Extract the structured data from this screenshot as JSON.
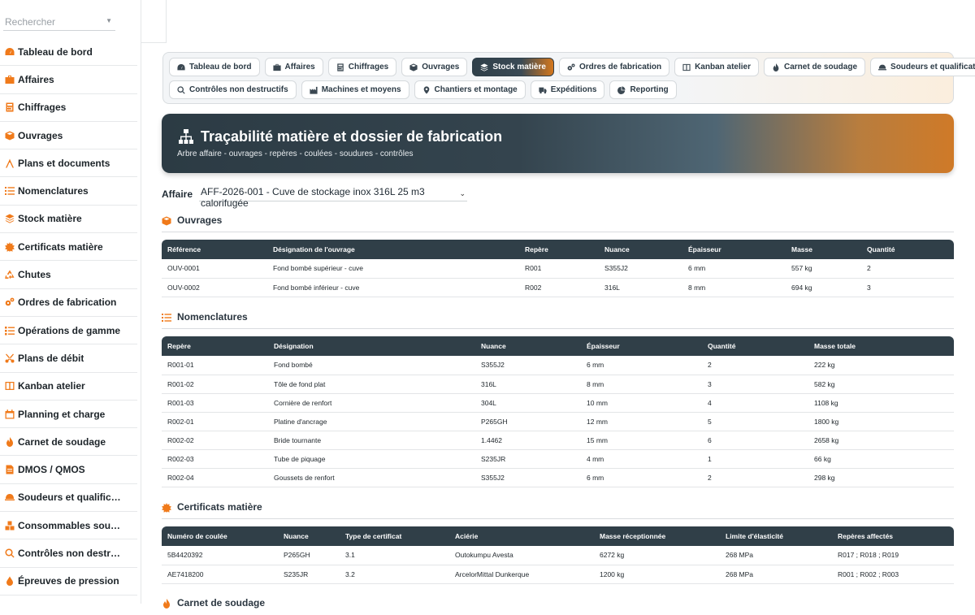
{
  "sidebar": {
    "search_placeholder": "Rechercher",
    "items": [
      {
        "label": "Tableau de bord",
        "icon": "dashboard-icon"
      },
      {
        "label": "Affaires",
        "icon": "briefcase-icon"
      },
      {
        "label": "Chiffrages",
        "icon": "calculator-icon"
      },
      {
        "label": "Ouvrages",
        "icon": "cube-icon"
      },
      {
        "label": "Plans et documents",
        "icon": "compass-icon"
      },
      {
        "label": "Nomenclatures",
        "icon": "list-icon"
      },
      {
        "label": "Stock matière",
        "icon": "layers-icon"
      },
      {
        "label": "Certificats matière",
        "icon": "certificate-icon"
      },
      {
        "label": "Chutes",
        "icon": "recycle-icon"
      },
      {
        "label": "Ordres de fabrication",
        "icon": "gears-icon"
      },
      {
        "label": "Opérations de gamme",
        "icon": "tasks-icon"
      },
      {
        "label": "Plans de débit",
        "icon": "scissors-icon"
      },
      {
        "label": "Kanban atelier",
        "icon": "kanban-icon"
      },
      {
        "label": "Planning et charge",
        "icon": "calendar-icon"
      },
      {
        "label": "Carnet de soudage",
        "icon": "flame-icon"
      },
      {
        "label": "DMOS / QMOS",
        "icon": "document-icon"
      },
      {
        "label": "Soudeurs et qualific…",
        "icon": "hardhat-icon"
      },
      {
        "label": "Consommables sou…",
        "icon": "boxes-icon"
      },
      {
        "label": "Contrôles non destr…",
        "icon": "search-icon"
      },
      {
        "label": "Épreuves de pression",
        "icon": "drop-icon"
      }
    ]
  },
  "nav": {
    "row1": [
      {
        "label": "Tableau de bord",
        "icon": "dashboard-icon",
        "active": false
      },
      {
        "label": "Affaires",
        "icon": "briefcase-icon",
        "active": false
      },
      {
        "label": "Chiffrages",
        "icon": "calculator-icon",
        "active": false
      },
      {
        "label": "Ouvrages",
        "icon": "cube-icon",
        "active": false
      },
      {
        "label": "Stock matière",
        "icon": "layers-icon",
        "active": true
      },
      {
        "label": "Ordres de fabrication",
        "icon": "gears-icon",
        "active": false
      },
      {
        "label": "Kanban atelier",
        "icon": "kanban-icon",
        "active": false
      },
      {
        "label": "Carnet de soudage",
        "icon": "flame-icon",
        "active": false
      },
      {
        "label": "Soudeurs et qualifications",
        "icon": "hardhat-icon",
        "active": false
      }
    ],
    "row2": [
      {
        "label": "Contrôles non destructifs",
        "icon": "search-icon",
        "active": false
      },
      {
        "label": "Machines et moyens",
        "icon": "factory-icon",
        "active": false
      },
      {
        "label": "Chantiers et montage",
        "icon": "pin-icon",
        "active": false
      },
      {
        "label": "Expéditions",
        "icon": "truck-icon",
        "active": false
      },
      {
        "label": "Reporting",
        "icon": "pie-icon",
        "active": false
      }
    ]
  },
  "hero": {
    "title": "Traçabilité matière et dossier de fabrication",
    "subtitle": "Arbre affaire - ouvrages - repères - coulées - soudures - contrôles"
  },
  "affaire": {
    "label": "Affaire",
    "value": "AFF-2026-001 - Cuve de stockage inox 316L 25 m3 calorifugée"
  },
  "ouvrages": {
    "title": "Ouvrages",
    "columns": [
      "Référence",
      "Désignation de l'ouvrage",
      "Repère",
      "Nuance",
      "Épaisseur",
      "Masse",
      "Quantité"
    ],
    "rows": [
      [
        "OUV-0001",
        "Fond bombé supérieur - cuve",
        "R001",
        "S355J2",
        "6 mm",
        "557 kg",
        "2"
      ],
      [
        "OUV-0002",
        "Fond bombé inférieur - cuve",
        "R002",
        "316L",
        "8 mm",
        "694 kg",
        "3"
      ]
    ]
  },
  "nomenclatures": {
    "title": "Nomenclatures",
    "columns": [
      "Repère",
      "Désignation",
      "Nuance",
      "Épaisseur",
      "Quantité",
      "Masse totale"
    ],
    "rows": [
      [
        "R001-01",
        "Fond bombé",
        "S355J2",
        "6 mm",
        "2",
        "222 kg"
      ],
      [
        "R001-02",
        "Tôle de fond plat",
        "316L",
        "8 mm",
        "3",
        "582 kg"
      ],
      [
        "R001-03",
        "Cornière de renfort",
        "304L",
        "10 mm",
        "4",
        "1108 kg"
      ],
      [
        "R002-01",
        "Platine d'ancrage",
        "P265GH",
        "12 mm",
        "5",
        "1800 kg"
      ],
      [
        "R002-02",
        "Bride tournante",
        "1.4462",
        "15 mm",
        "6",
        "2658 kg"
      ],
      [
        "R002-03",
        "Tube de piquage",
        "S235JR",
        "4 mm",
        "1",
        "66 kg"
      ],
      [
        "R002-04",
        "Goussets de renfort",
        "S355J2",
        "6 mm",
        "2",
        "298 kg"
      ]
    ]
  },
  "certificats": {
    "title": "Certificats matière",
    "columns": [
      "Numéro de coulée",
      "Nuance",
      "Type de certificat",
      "Aciérie",
      "Masse réceptionnée",
      "Limite d'élasticité",
      "Repères affectés"
    ],
    "rows": [
      [
        "5B4420392",
        "P265GH",
        "3.1",
        "Outokumpu Avesta",
        "6272 kg",
        "268 MPa",
        "R017 ; R018 ; R019"
      ],
      [
        "AE7418200",
        "S235JR",
        "3.2",
        "ArcelorMittal Dunkerque",
        "1200 kg",
        "268 MPa",
        "R001 ; R002 ; R003"
      ]
    ]
  },
  "carnet": {
    "title": "Carnet de soudage"
  },
  "colors": {
    "accent": "#f07a1a",
    "dark": "#303f48"
  }
}
